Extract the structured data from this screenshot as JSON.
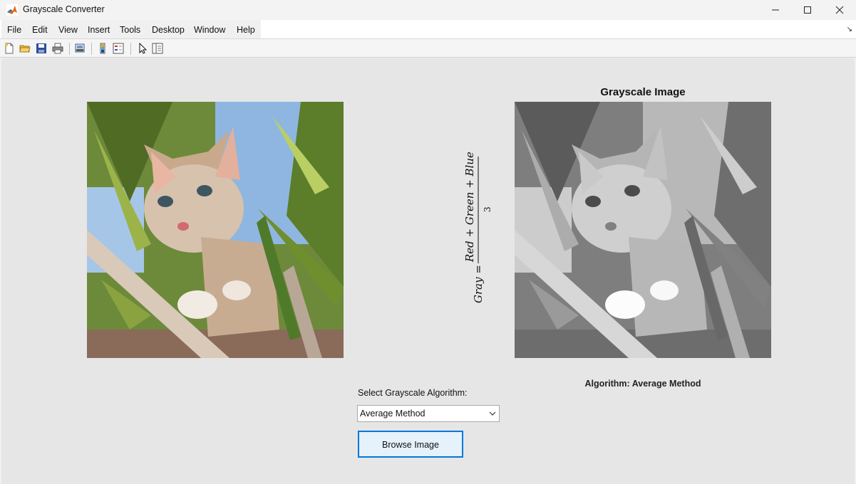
{
  "window": {
    "title": "Grayscale Converter"
  },
  "menubar": {
    "items": [
      "File",
      "Edit",
      "View",
      "Insert",
      "Tools",
      "Desktop",
      "Window",
      "Help"
    ]
  },
  "figure": {
    "axes_title": "Grayscale Image",
    "formula": {
      "lhs": "Gray =",
      "numerator": "Red + Green + Blue",
      "denominator": "3"
    },
    "algorithm_label": "Algorithm: Average Method"
  },
  "controls": {
    "select_label": "Select Grayscale Algorithm:",
    "dropdown_value": "Average Method",
    "browse_label": "Browse Image"
  },
  "icons": [
    "matlab-logo-icon",
    "new-figure-icon",
    "open-file-icon",
    "save-icon",
    "print-icon",
    "print-preview-icon",
    "colorbar-icon",
    "legend-icon",
    "pointer-icon",
    "property-inspector-icon",
    "chevron-down-icon"
  ],
  "colors": {
    "figure_bg": "#e6e6e6",
    "button_focus": "#0078d7",
    "button_fill": "#e5f1fb"
  }
}
